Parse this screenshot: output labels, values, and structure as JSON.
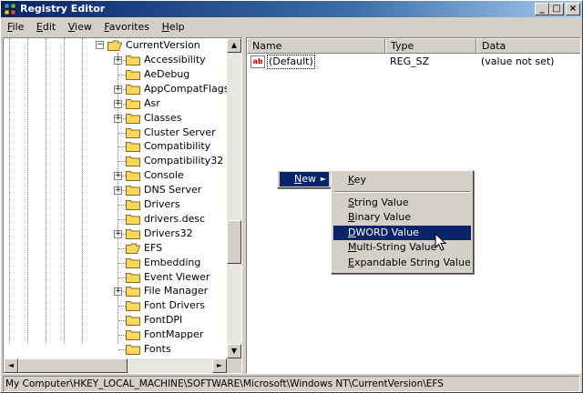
{
  "window": {
    "title": "Registry Editor",
    "btn_min": "_",
    "btn_max": "□",
    "btn_close": "×"
  },
  "menu": [
    {
      "label": "File",
      "accel": "F",
      "rest": "ile"
    },
    {
      "label": "Edit",
      "accel": "E",
      "rest": "dit"
    },
    {
      "label": "View",
      "accel": "V",
      "rest": "iew"
    },
    {
      "label": "Favorites",
      "accel": "F",
      "rest": "avorites",
      "prefix": ""
    },
    {
      "label": "Help",
      "accel": "H",
      "rest": "elp"
    }
  ],
  "tree": {
    "parent": "CurrentVersion",
    "items": [
      {
        "label": "Accessibility",
        "expandable": true
      },
      {
        "label": "AeDebug",
        "expandable": false
      },
      {
        "label": "AppCompatFlags",
        "expandable": true
      },
      {
        "label": "Asr",
        "expandable": true
      },
      {
        "label": "Classes",
        "expandable": true
      },
      {
        "label": "Cluster Server",
        "expandable": false
      },
      {
        "label": "Compatibility",
        "expandable": false
      },
      {
        "label": "Compatibility32",
        "expandable": false
      },
      {
        "label": "Console",
        "expandable": true
      },
      {
        "label": "DNS Server",
        "expandable": true
      },
      {
        "label": "Drivers",
        "expandable": false
      },
      {
        "label": "drivers.desc",
        "expandable": false
      },
      {
        "label": "Drivers32",
        "expandable": true
      },
      {
        "label": "EFS",
        "expandable": false,
        "open": true
      },
      {
        "label": "Embedding",
        "expandable": false
      },
      {
        "label": "Event Viewer",
        "expandable": false
      },
      {
        "label": "File Manager",
        "expandable": true
      },
      {
        "label": "Font Drivers",
        "expandable": false
      },
      {
        "label": "FontDPI",
        "expandable": false
      },
      {
        "label": "FontMapper",
        "expandable": false
      },
      {
        "label": "Fonts",
        "expandable": false
      }
    ]
  },
  "list": {
    "columns": [
      "Name",
      "Type",
      "Data"
    ],
    "rows": [
      {
        "icon": "ab",
        "name": "(Default)",
        "type": "REG_SZ",
        "data": "(value not set)"
      }
    ]
  },
  "context_menu": {
    "new_label": "New",
    "new_accel": "N",
    "submenu": [
      {
        "label": "Key",
        "accel": "K",
        "rest": "ey"
      },
      {
        "label": "String Value",
        "accel": "S",
        "rest": "tring Value"
      },
      {
        "label": "Binary Value",
        "accel": "B",
        "rest": "inary Value"
      },
      {
        "label": "DWORD Value",
        "accel": "D",
        "rest": "WORD Value"
      },
      {
        "label": "Multi-String Value",
        "accel": "M",
        "rest": "ulti-String Value"
      },
      {
        "label": "Expandable String Value",
        "accel": "E",
        "rest": "xpandable String Value"
      }
    ],
    "selected": "DWORD Value"
  },
  "status": "My Computer\\HKEY_LOCAL_MACHINE\\SOFTWARE\\Microsoft\\Windows NT\\CurrentVersion\\EFS",
  "colors": {
    "title_active": "#0a246a",
    "selection": "#0a246a",
    "chrome": "#d4d0c8",
    "folder": "#f8d860"
  }
}
